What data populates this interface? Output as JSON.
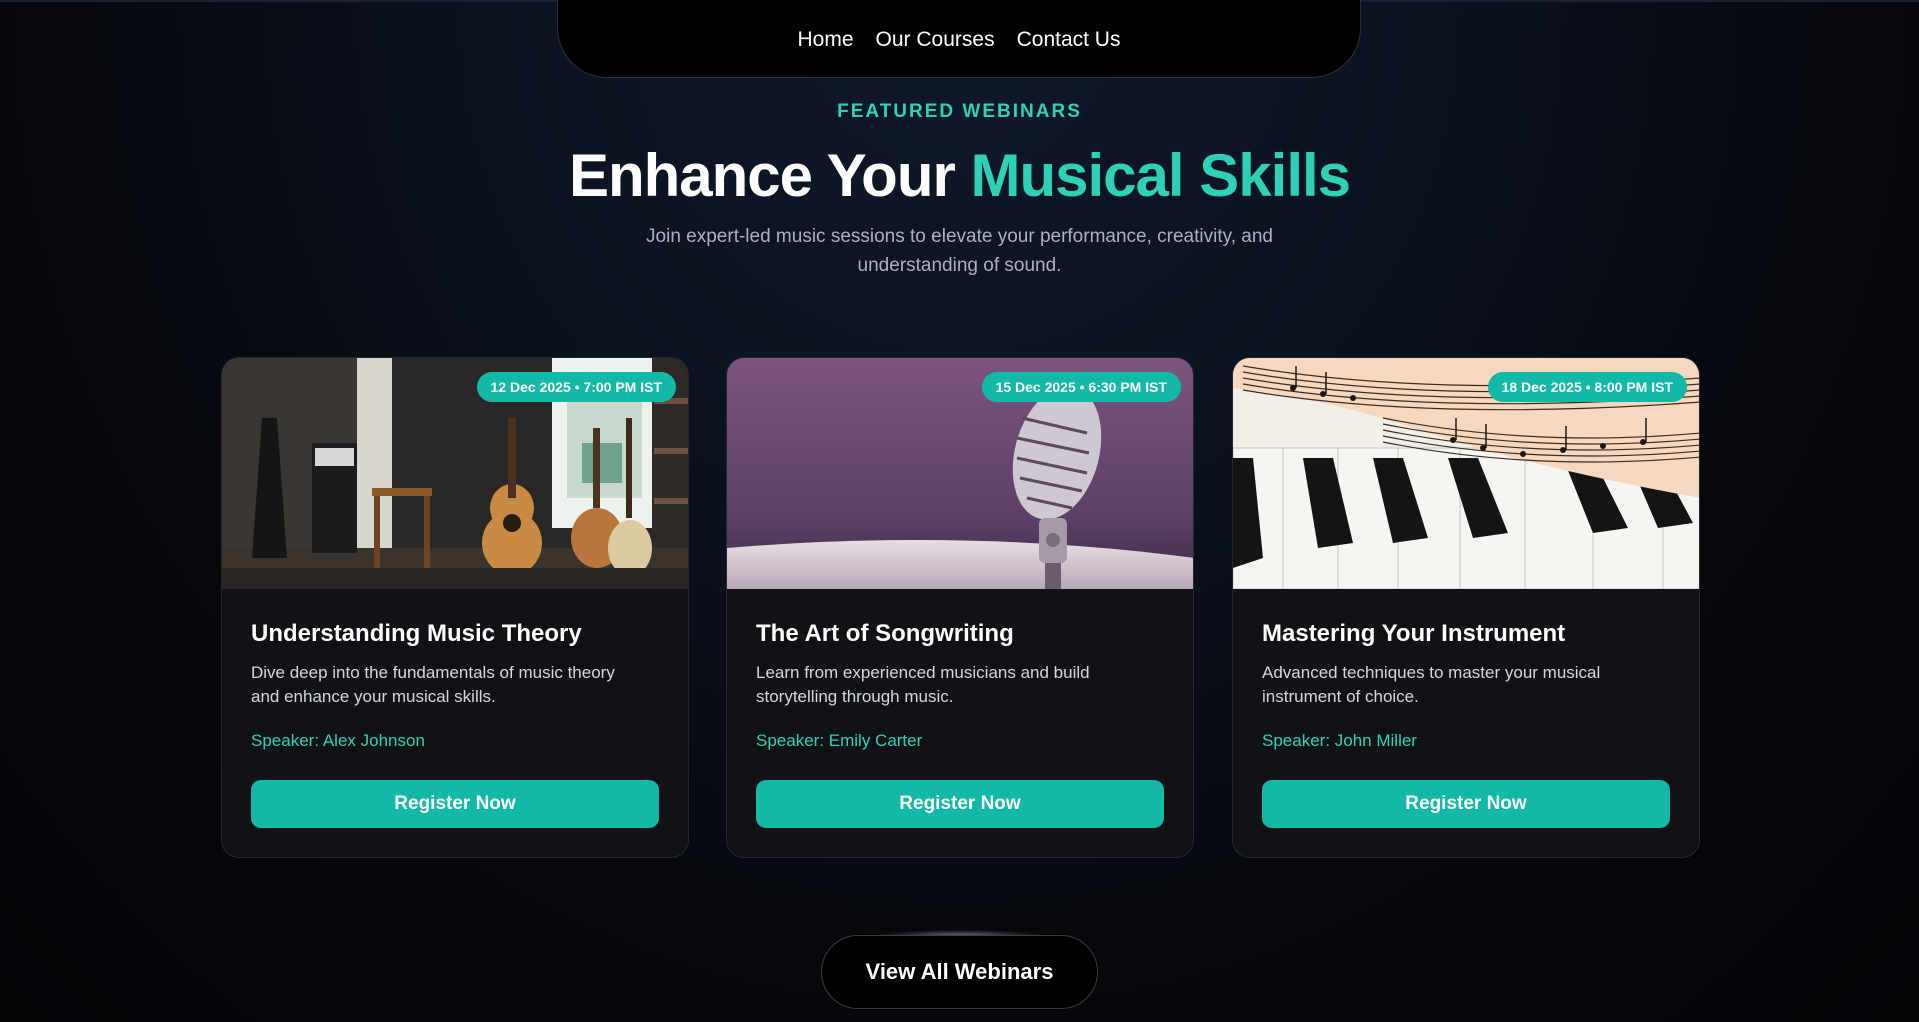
{
  "nav": {
    "links": [
      "Home",
      "Our Courses",
      "Contact Us"
    ]
  },
  "hero": {
    "eyebrow": "FEATURED WEBINARS",
    "title_part1": "Enhance Your ",
    "title_accent": "Musical Skills",
    "subtitle_line1": "Join expert-led music sessions to elevate your performance, creativity, and",
    "subtitle_line2": "understanding of sound."
  },
  "webinars": [
    {
      "date": "12 Dec 2025 • 7:00 PM IST",
      "title": "Understanding Music Theory",
      "desc_line1": "Dive deep into the fundamentals of music theory",
      "desc_line2": "and enhance your musical skills.",
      "speaker": "Speaker: Alex Johnson",
      "cta": "Register Now",
      "image": "guitars-room-photo"
    },
    {
      "date": "15 Dec 2025 • 6:30 PM IST",
      "title": "The Art of Songwriting",
      "desc_line1": "Learn from experienced musicians and build",
      "desc_line2": "storytelling through music.",
      "speaker": "Speaker: Emily Carter",
      "cta": "Register Now",
      "image": "vintage-microphone-photo"
    },
    {
      "date": "18 Dec 2025 • 8:00 PM IST",
      "title": "Mastering Your Instrument",
      "desc_line1": "Advanced techniques to master your musical",
      "desc_line2": "instrument of choice.",
      "speaker": "Speaker: John Miller",
      "cta": "Register Now",
      "image": "piano-sheet-music-photo"
    }
  ],
  "view_all_label": "View All Webinars",
  "colors": {
    "accent": "#2fd1b6",
    "button": "#14b8a6",
    "card_bg": "#111215",
    "page_bg": "#0b1220"
  }
}
